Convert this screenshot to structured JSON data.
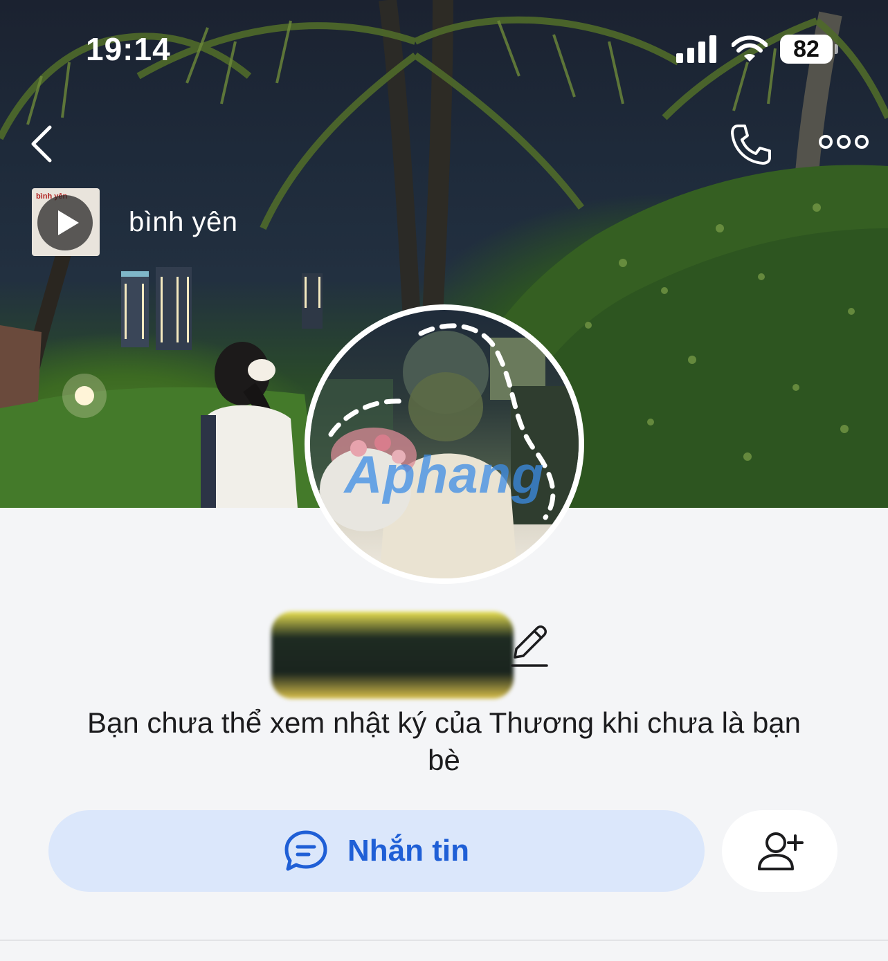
{
  "status_bar": {
    "time": "19:14",
    "battery": "82",
    "icons": [
      "signal-icon",
      "wifi-icon",
      "battery-icon"
    ]
  },
  "nav": {
    "icons": [
      "back-icon",
      "phone-icon",
      "more-icon"
    ]
  },
  "music": {
    "title": "bình yên",
    "thumbnail_text": "bình yên",
    "icon": "play-icon"
  },
  "avatar": {
    "watermark": "Aphang"
  },
  "profile": {
    "edit_icon": "pencil-icon",
    "notice": "Bạn chưa thể xem nhật ký của Thương khi chưa là bạn bè"
  },
  "actions": {
    "message_label": "Nhắn tin",
    "message_icon": "chat-bubble-icon",
    "add_friend_icon": "add-friend-icon"
  },
  "colors": {
    "accent": "#1f5fd6",
    "message_button_bg": "#dbe7fb",
    "page_bg": "#f4f5f7"
  }
}
